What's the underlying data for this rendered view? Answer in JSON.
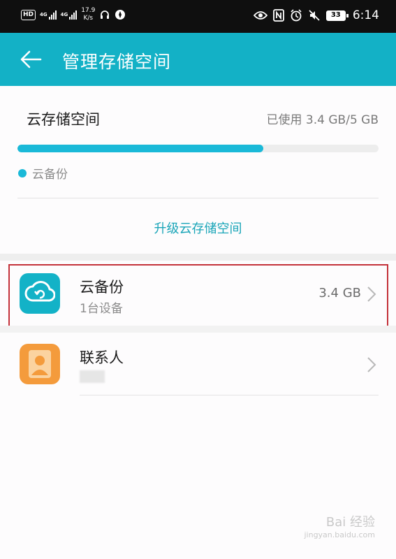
{
  "status_bar": {
    "hd": "HD",
    "net1": "4G",
    "net2": "4G",
    "speed_value": "17.9",
    "speed_unit": "K/s",
    "battery": "33",
    "time": "6:14"
  },
  "app_bar": {
    "title": "管理存储空间"
  },
  "storage": {
    "title": "云存储空间",
    "used_text": "已使用 3.4 GB/5 GB",
    "used_fraction": 0.68,
    "legend_label": "云备份",
    "upgrade_label": "升级云存储空间",
    "accent_color": "#1ab9d8"
  },
  "items": [
    {
      "title": "云备份",
      "subtitle": "1台设备",
      "value": "3.4 GB",
      "icon": "cloud-backup-icon"
    },
    {
      "title": "联系人",
      "subtitle": "",
      "value": "",
      "icon": "contacts-icon"
    }
  ],
  "watermark": {
    "line1": "Bai 经验",
    "line2": "jingyan.baidu.com"
  }
}
